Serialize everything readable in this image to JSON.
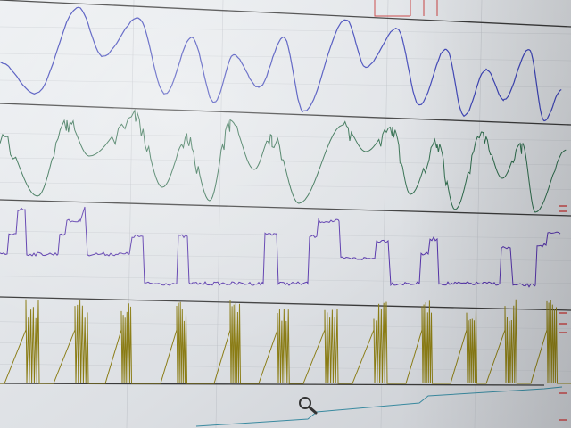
{
  "window": {
    "background": "#dde1e5"
  },
  "toolbar": {
    "zoom_icon": "magnifier-icon"
  },
  "colors": {
    "gridline": "#b8bcc2",
    "separator": "#3a3a3a",
    "trace_1": "#3d44b8",
    "trace_2": "#2c6a4a",
    "trace_3": "#5533aa",
    "trace_4": "#8a7c14",
    "axis_marker": "#c84040",
    "baseline": "#3a8aa0"
  },
  "tracks": [
    {
      "name": "track-1"
    },
    {
      "name": "track-2"
    },
    {
      "name": "track-3"
    },
    {
      "name": "track-4"
    }
  ]
}
